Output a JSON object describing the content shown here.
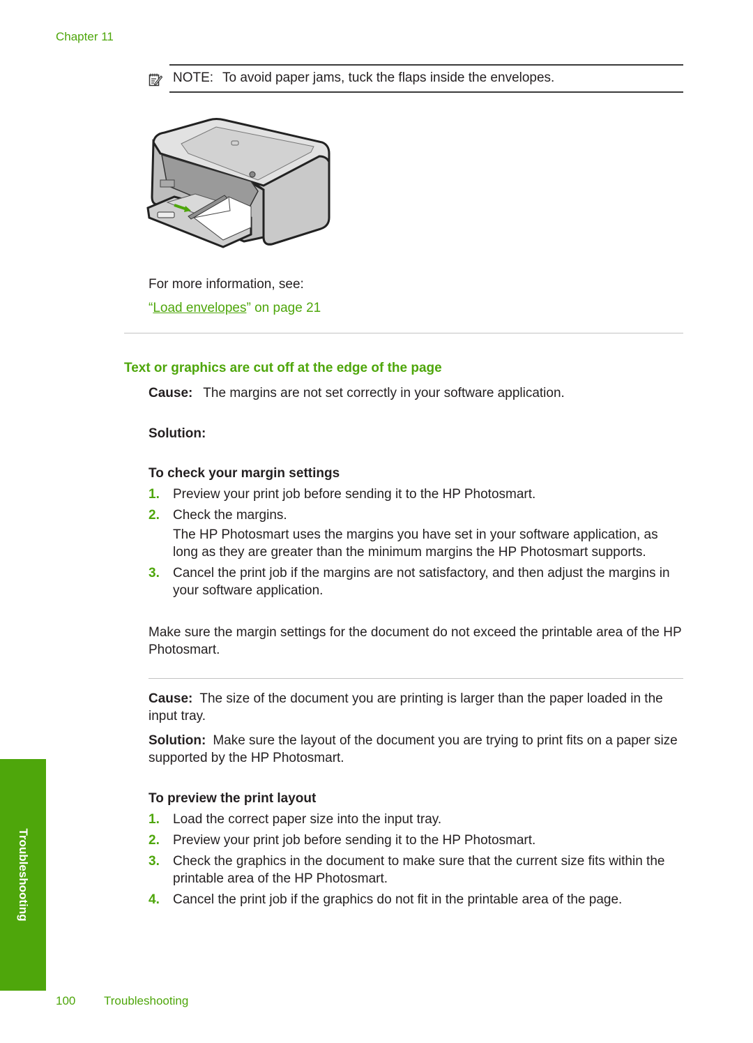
{
  "header": {
    "chapter": "Chapter 11"
  },
  "note": {
    "icon": "note-pencil-icon",
    "label": "NOTE:",
    "text": "To avoid paper jams, tuck the flaps inside the envelopes."
  },
  "figure": {
    "description": "Printer with envelopes loaded in input tray"
  },
  "more_info": {
    "text": "For more information, see:",
    "link_open_quote": "“",
    "link_text": "Load envelopes",
    "link_suffix": "” on page 21"
  },
  "section": {
    "heading": "Text or graphics are cut off at the edge of the page",
    "cause1": {
      "label": "Cause:",
      "text": "The margins are not set correctly in your software application."
    },
    "solution1": {
      "label": "Solution:"
    },
    "procedure1": {
      "title": "To check your margin settings",
      "steps": [
        {
          "num": "1.",
          "text": "Preview your print job before sending it to the HP Photosmart."
        },
        {
          "num": "2.",
          "text": "Check the margins.",
          "extra": "The HP Photosmart uses the margins you have set in your software application, as long as they are greater than the minimum margins the HP Photosmart supports."
        },
        {
          "num": "3.",
          "text": "Cancel the print job if the margins are not satisfactory, and then adjust the margins in your software application."
        }
      ]
    },
    "paragraph": "Make sure the margin settings for the document do not exceed the printable area of the HP Photosmart.",
    "cause2": {
      "label": "Cause:",
      "text": "The size of the document you are printing is larger than the paper loaded in the input tray."
    },
    "solution2": {
      "label": "Solution:",
      "text": "Make sure the layout of the document you are trying to print fits on a paper size supported by the HP Photosmart."
    },
    "procedure2": {
      "title": "To preview the print layout",
      "steps": [
        {
          "num": "1.",
          "text": "Load the correct paper size into the input tray."
        },
        {
          "num": "2.",
          "text": "Preview your print job before sending it to the HP Photosmart."
        },
        {
          "num": "3.",
          "text": "Check the graphics in the document to make sure that the current size fits within the printable area of the HP Photosmart."
        },
        {
          "num": "4.",
          "text": "Cancel the print job if the graphics do not fit in the printable area of the page."
        }
      ]
    }
  },
  "side_tab": {
    "label": "Troubleshooting"
  },
  "footer": {
    "page_number": "100",
    "title": "Troubleshooting"
  },
  "colors": {
    "accent": "#4ea60b",
    "text": "#231f20",
    "rule": "#c2c2c2"
  }
}
